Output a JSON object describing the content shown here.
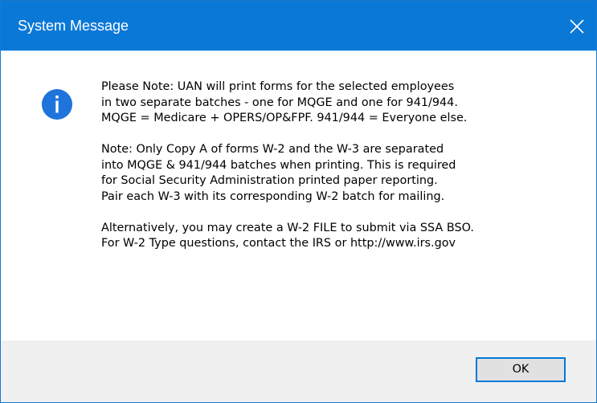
{
  "window": {
    "title": "System Message"
  },
  "icons": {
    "close": "close-icon",
    "info": "info-icon",
    "info_color": "#1c6fd6"
  },
  "message": {
    "paragraphs": [
      "Please Note: UAN will print forms for the selected employees\nin two separate batches - one for MQGE and one for 941/944.\nMQGE = Medicare + OPERS/OP&FPF. 941/944 = Everyone else.",
      "Note: Only Copy A of forms W-2 and the W-3 are separated\ninto MQGE & 941/944 batches when printing. This is required\nfor Social Security Administration printed paper reporting.\nPair each W-3 with its corresponding W-2 batch for mailing.",
      "Alternatively, you may create a W-2 FILE to submit via SSA BSO.\nFor W-2 Type questions, contact the IRS or http://www.irs.gov"
    ]
  },
  "buttons": {
    "ok_label": "OK"
  },
  "colors": {
    "titlebar": "#0a78d7",
    "footer": "#f0f0f0",
    "button_border": "#0078d7"
  }
}
